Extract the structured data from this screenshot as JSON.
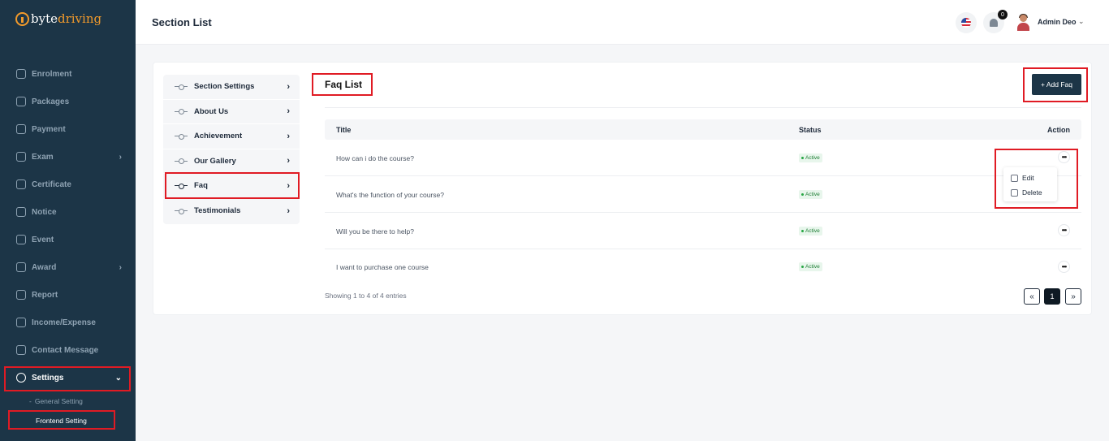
{
  "brand": {
    "name_part1": "byte",
    "name_part2": "driving",
    "accent_color": "#f19a2b",
    "sidebar_color": "#1c3547"
  },
  "sidebar": {
    "items": [
      {
        "label": "Enrolment",
        "icon": "enrolment-icon"
      },
      {
        "label": "Packages",
        "icon": "packages-icon"
      },
      {
        "label": "Payment",
        "icon": "payment-icon"
      },
      {
        "label": "Exam",
        "icon": "exam-icon",
        "chevron": "›"
      },
      {
        "label": "Certificate",
        "icon": "certificate-icon"
      },
      {
        "label": "Notice",
        "icon": "notice-icon"
      },
      {
        "label": "Event",
        "icon": "event-icon"
      },
      {
        "label": "Award",
        "icon": "award-icon",
        "chevron": "›"
      },
      {
        "label": "Report",
        "icon": "report-icon"
      },
      {
        "label": "Income/Expense",
        "icon": "wallet-icon"
      },
      {
        "label": "Contact Message",
        "icon": "message-icon"
      }
    ],
    "settings": {
      "label": "Settings",
      "chevron": "⌄"
    },
    "sub_items": {
      "general": "General Setting",
      "frontend": "Frontend Setting",
      "dash": "-"
    }
  },
  "header": {
    "title": "Section List",
    "notification_count": "0",
    "user_name": "Admin Deo",
    "user_chevron": "⌄"
  },
  "section_menu": {
    "items": [
      {
        "label": "Section Settings",
        "arrow": "›"
      },
      {
        "label": "About Us",
        "arrow": "›"
      },
      {
        "label": "Achievement",
        "arrow": "›"
      },
      {
        "label": "Our Gallery",
        "arrow": "›"
      },
      {
        "label": "Faq",
        "arrow": "›",
        "active": true
      },
      {
        "label": "Testimonials",
        "arrow": "›"
      }
    ]
  },
  "faq": {
    "title": "Faq List",
    "add_button": "+ Add Faq",
    "columns": {
      "title": "Title",
      "status": "Status",
      "action": "Action"
    },
    "rows": [
      {
        "title": "How can i do the course?",
        "status": "Active"
      },
      {
        "title": "What's the function of your course?",
        "status": "Active"
      },
      {
        "title": "Will you be there to help?",
        "status": "Active"
      },
      {
        "title": "I want to purchase one course",
        "status": "Active"
      }
    ],
    "more_glyph": "•••",
    "dropdown": {
      "edit": "Edit",
      "delete": "Delete"
    },
    "entries_text": "Showing 1 to 4 of 4 entries",
    "pagination": {
      "prev": "«",
      "current": "1",
      "next": "»"
    }
  }
}
